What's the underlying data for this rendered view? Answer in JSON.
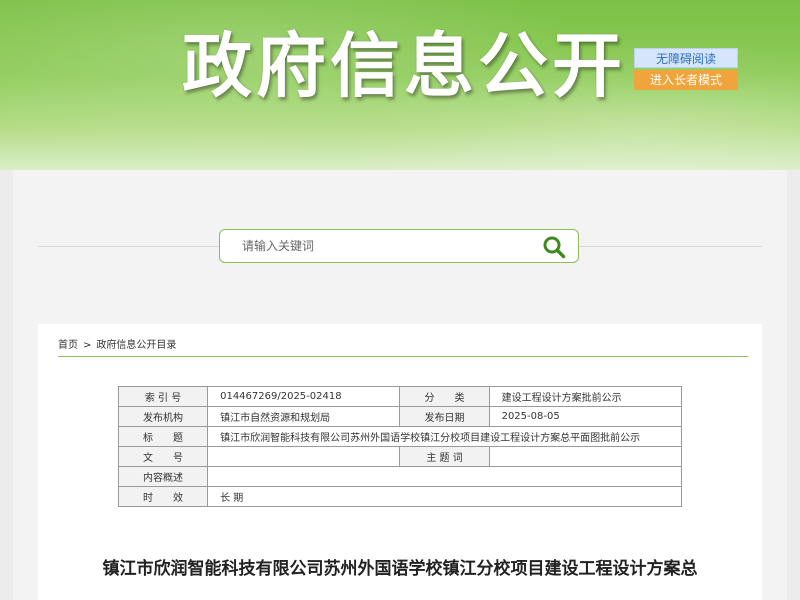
{
  "header": {
    "title": "政府信息公开",
    "accessibility_label": "无障碍阅读",
    "elder_mode_label": "进入长者模式"
  },
  "search": {
    "placeholder": "请输入关键词",
    "icon": "search-icon"
  },
  "breadcrumb": {
    "items": [
      "首页",
      "政府信息公开目录"
    ],
    "separator": ">"
  },
  "meta_table": {
    "index_label": "索 引 号",
    "index_value": "014467269/2025-02418",
    "category_label": "分　　类",
    "category_value": "建设工程设计方案批前公示",
    "publisher_label": "发布机构",
    "publisher_value": "镇江市自然资源和规划局",
    "date_label": "发布日期",
    "date_value": "2025-08-05",
    "title_label": "标　　题",
    "title_value": "镇江市欣润智能科技有限公司苏州外国语学校镇江分校项目建设工程设计方案总平面图批前公示",
    "doc_no_label": "文　　号",
    "doc_no_value": "",
    "subject_label": "主 题 词",
    "subject_value": "",
    "summary_label": "内容概述",
    "summary_value": "",
    "validity_label": "时　　效",
    "validity_value": "长 期"
  },
  "article": {
    "title": "镇江市欣润智能科技有限公司苏州外国语学校镇江分校项目建设工程设计方案总"
  },
  "colors": {
    "banner_green": "#7cc146",
    "accent_green": "#8cbd5a",
    "elder_orange": "#f0a53c",
    "access_blue": "#d6e6fa"
  }
}
